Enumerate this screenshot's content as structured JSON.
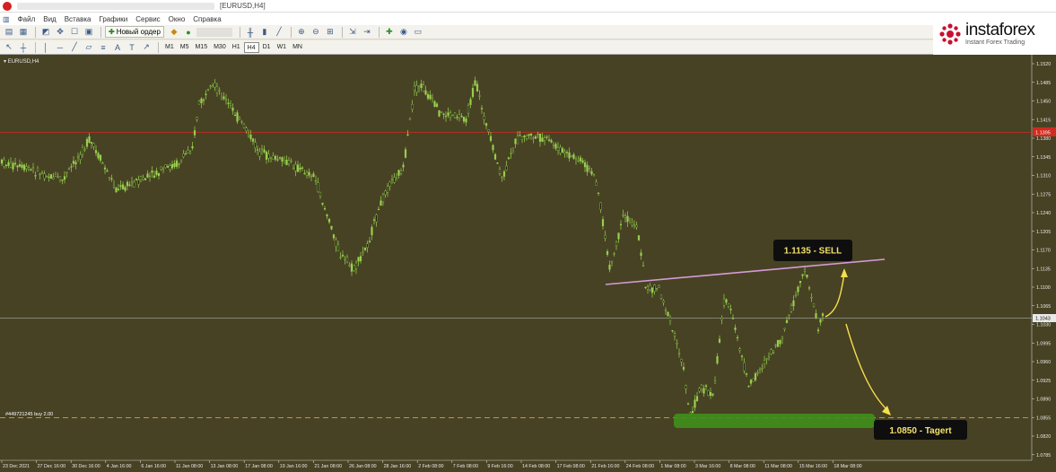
{
  "window": {
    "title": "[EURUSD,H4]"
  },
  "menu": [
    {
      "label": "Файл",
      "key": "menu-file"
    },
    {
      "label": "Вид",
      "key": "menu-view"
    },
    {
      "label": "Вставка",
      "key": "menu-insert"
    },
    {
      "label": "Графики",
      "key": "menu-charts"
    },
    {
      "label": "Сервис",
      "key": "menu-tools"
    },
    {
      "label": "Окно",
      "key": "menu-window"
    },
    {
      "label": "Справка",
      "key": "menu-help"
    }
  ],
  "toolbar": {
    "new_order_label": "Новый ордер",
    "timeframes": [
      "M1",
      "M5",
      "M15",
      "M30",
      "H1",
      "H4",
      "D1",
      "W1",
      "MN"
    ],
    "active_timeframe": "H4"
  },
  "brand": {
    "name": "instaforex",
    "tagline": "Instant Forex Trading",
    "color": "#c8102e"
  },
  "chart": {
    "symbol_label": "EURUSD,H4",
    "order_line_label": "#449721245 buy 2.00",
    "current_price_label": "1.1043",
    "resistance_price_label": "1.1395",
    "bg": "#474224",
    "candle_color": "#9bd34f",
    "price_scale": [
      "1.1520",
      "1.1485",
      "1.1450",
      "1.1415",
      "1.1380",
      "1.1345",
      "1.1310",
      "1.1275",
      "1.1240",
      "1.1205",
      "1.1170",
      "1.1135",
      "1.1100",
      "1.1065",
      "1.1030",
      "1.0995",
      "1.0960",
      "1.0925",
      "1.0890",
      "1.0855",
      "1.0820",
      "1.0785"
    ],
    "time_scale": [
      "23 Dec 2021",
      "27 Dec 16:00",
      "30 Dec 16:00",
      "4 Jan 16:00",
      "6 Jan 16:00",
      "11 Jan 08:00",
      "13 Jan 08:00",
      "17 Jan 08:00",
      "19 Jan 16:00",
      "21 Jan 08:00",
      "26 Jan 08:00",
      "28 Jan 16:00",
      "2 Feb 08:00",
      "7 Feb 08:00",
      "9 Feb 16:00",
      "14 Feb 08:00",
      "17 Feb 08:00",
      "21 Feb 16:00",
      "24 Feb 08:00",
      "1 Mar 08:00",
      "3 Mar 16:00",
      "8 Mar 08:00",
      "11 Mar 08:00",
      "15 Mar 16:00",
      "18 Mar 08:00"
    ],
    "sell_label": "1.1135 - SELL",
    "target_label": "1.0850 - Tagert"
  }
}
